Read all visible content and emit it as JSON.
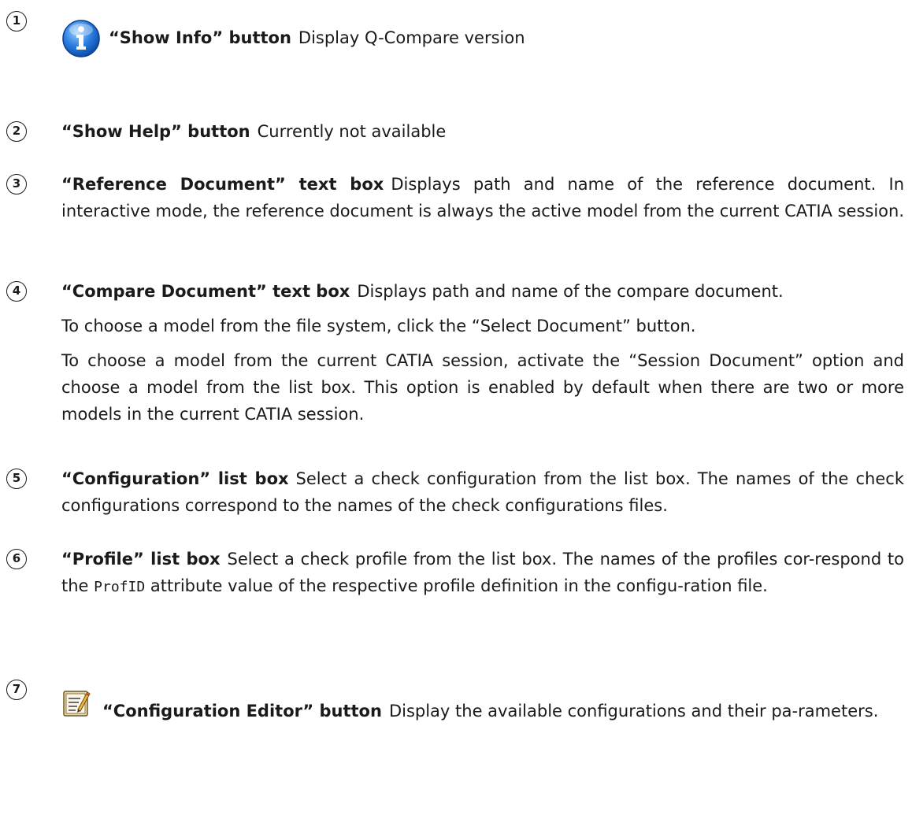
{
  "entries": [
    {
      "number": "1",
      "icon": "info-icon",
      "term": "“Show Info” button",
      "text": "Display Q-Compare version"
    },
    {
      "number": "2",
      "term": "“Show Help” button",
      "text": "Currently not available"
    },
    {
      "number": "3",
      "term": "“Reference Document” text box",
      "text": "Displays path and name of the reference document. In interactive mode, the reference document is always the active model from the current CATIA session."
    },
    {
      "number": "4",
      "term": "“Compare Document” text box",
      "text": "Displays path and name of the compare document.",
      "para2": "To choose a model from the file system, click the “Select Document” button.",
      "para3": "To choose a model from the current CATIA session, activate the “Session Document” option and choose a model from the list box. This option is enabled by default when there are two or more models in the current CATIA session."
    },
    {
      "number": "5",
      "term": "“Configuration” list box",
      "text": "Select a check configuration from the list box. The names of the check configurations correspond to the names of the check configurations files."
    },
    {
      "number": "6",
      "term": "“Profile” list box",
      "text_before": "Select a check profile from the list box. The names of the profiles cor-respond to the",
      "code": "ProfID",
      "text_after": "attribute value of the respective profile definition in the configu-ration file."
    },
    {
      "number": "7",
      "icon": "configuration-editor-icon",
      "term": "“Configuration Editor” button",
      "text": "Display the available configurations and their pa-rameters."
    }
  ]
}
